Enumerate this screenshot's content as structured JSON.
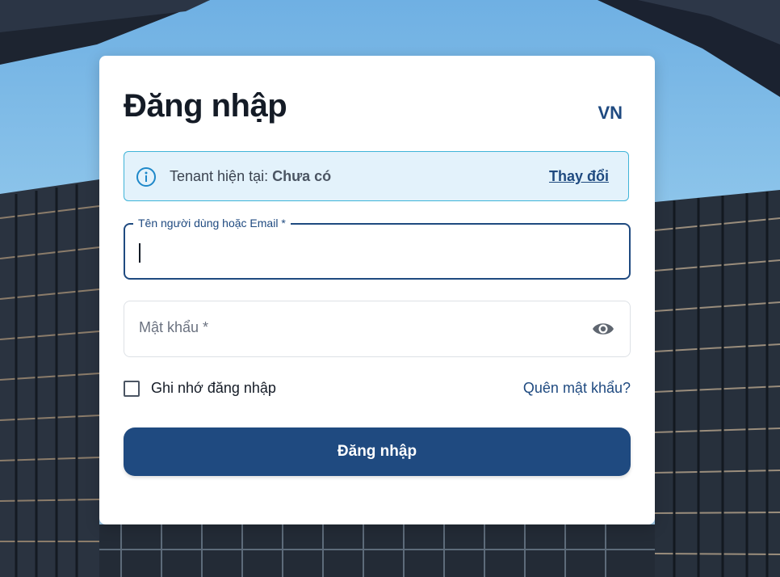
{
  "title": "Đăng nhập",
  "language": "VN",
  "tenant": {
    "label": "Tenant hiện tại:",
    "value": "Chưa có",
    "change_link": "Thay đổi"
  },
  "username": {
    "label": "Tên người dùng hoặc Email *",
    "value": ""
  },
  "password": {
    "placeholder": "Mật khẩu *",
    "value": ""
  },
  "remember": {
    "label": "Ghi nhớ đăng nhập",
    "checked": false
  },
  "forgot_link": "Quên mật khẩu?",
  "submit_label": "Đăng nhập",
  "colors": {
    "primary": "#1f4a80",
    "info_bg": "#e3f2fb",
    "info_border": "#3fb4d8"
  },
  "icons": {
    "info": "info-circle-icon",
    "eye": "eye-icon"
  }
}
